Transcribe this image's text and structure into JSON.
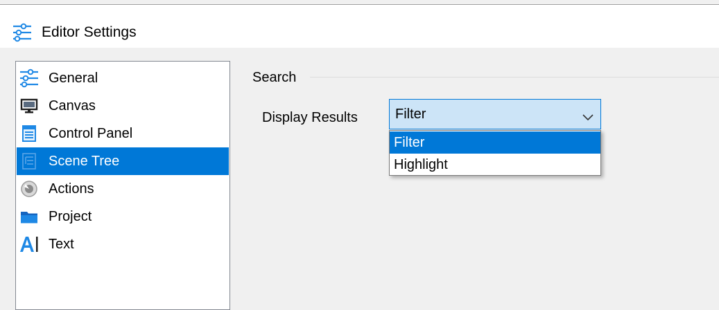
{
  "window": {
    "title": "Editor Settings",
    "icon": "settings-sliders-icon"
  },
  "nav": {
    "items": [
      {
        "label": "General",
        "icon": "settings-sliders-icon",
        "selected": false
      },
      {
        "label": "Canvas",
        "icon": "monitor-icon",
        "selected": false
      },
      {
        "label": "Control Panel",
        "icon": "control-panel-icon",
        "selected": false
      },
      {
        "label": "Scene Tree",
        "icon": "scene-tree-icon",
        "selected": true
      },
      {
        "label": "Actions",
        "icon": "actions-icon",
        "selected": false
      },
      {
        "label": "Project",
        "icon": "folder-icon",
        "selected": false
      },
      {
        "label": "Text",
        "icon": "text-icon",
        "selected": false
      }
    ]
  },
  "search": {
    "group_label": "Search",
    "display_results_label": "Display Results",
    "display_results_value": "Filter",
    "options": [
      "Filter",
      "Highlight"
    ],
    "highlighted_option": "Filter"
  },
  "colors": {
    "accent": "#0078d7",
    "combo_active_bg": "#cce4f7",
    "window_bg": "#f0f0f0",
    "panel_bg": "#ffffff"
  }
}
